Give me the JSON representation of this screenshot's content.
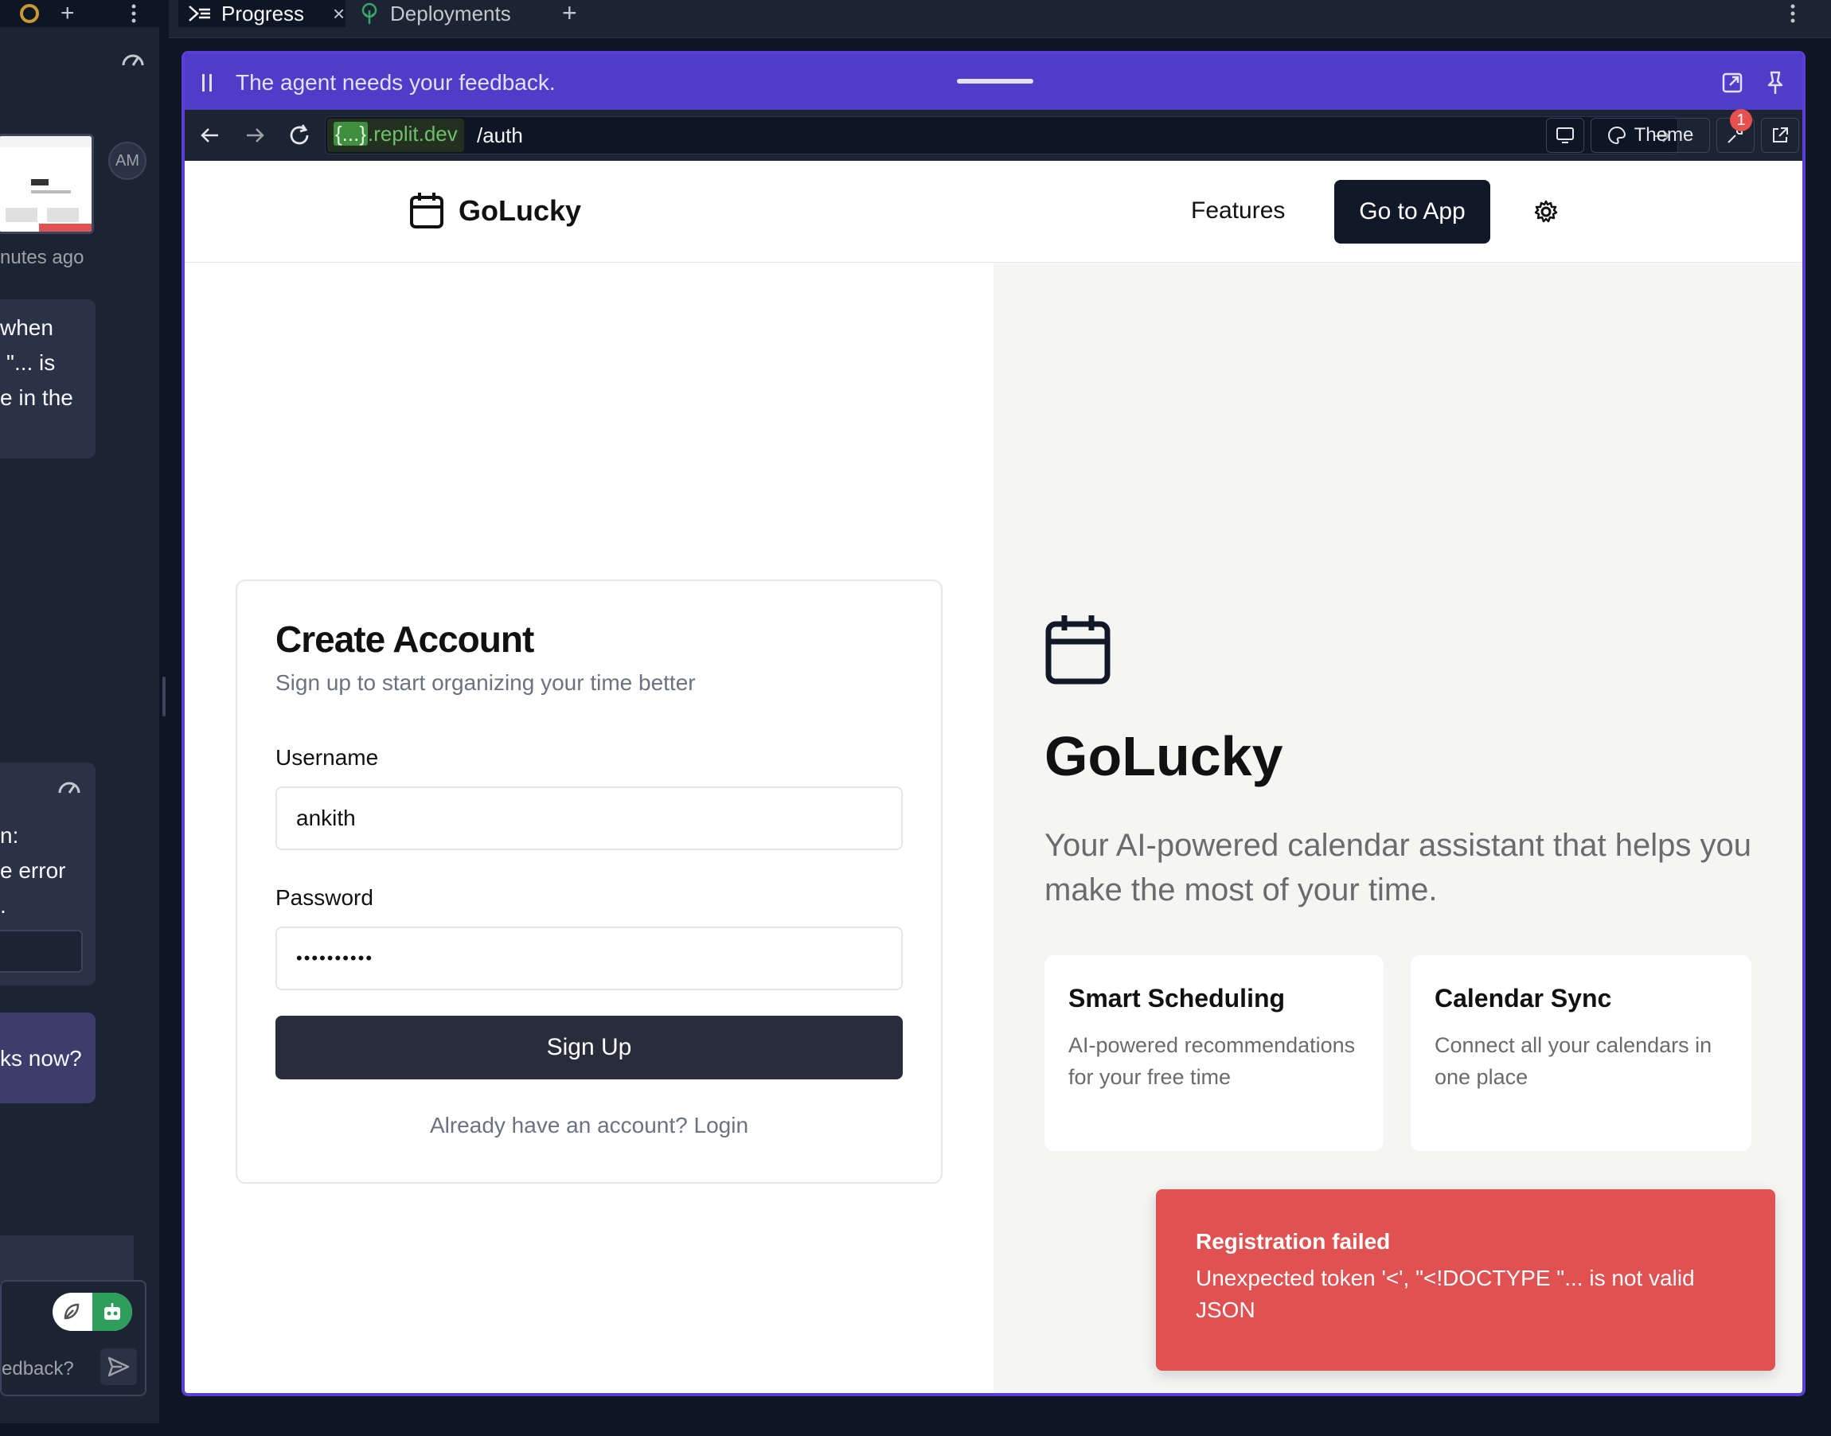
{
  "workspace": {
    "left_panel": {
      "timestamp": "nutes ago",
      "avatar": "AM",
      "message_1": [
        "when",
        "\"... is",
        "e in the"
      ],
      "message_2": [
        "n:",
        "e error",
        "."
      ],
      "message_3": "ks now?",
      "chat_placeholder": "edback?"
    },
    "tabs": [
      {
        "label": "Progress",
        "icon": "progress-icon"
      },
      {
        "label": "Deployments",
        "icon": "deployments-icon"
      }
    ]
  },
  "preview": {
    "feedback_banner": "The agent needs your feedback.",
    "url": {
      "domain": "{...}.replit.dev",
      "domain_prefix": "{...}",
      "domain_suffix": ".replit.dev",
      "path": "/auth"
    },
    "theme_label": "Theme",
    "notification_count": "1"
  },
  "app": {
    "brand": "GoLucky",
    "nav": {
      "features": "Features",
      "go_to_app": "Go to App"
    },
    "signup": {
      "title": "Create Account",
      "subtitle": "Sign up to start organizing your time better",
      "username_label": "Username",
      "username_value": "ankith",
      "password_label": "Password",
      "password_value": "••••••••••",
      "submit": "Sign Up",
      "login_link": "Already have an account? Login"
    },
    "hero": {
      "title": "GoLucky",
      "description": "Your AI-powered calendar assistant that helps you make the most of your time.",
      "features": [
        {
          "title": "Smart Scheduling",
          "text": "AI-powered recommendations for your free time"
        },
        {
          "title": "Calendar Sync",
          "text": "Connect all your calendars in one place"
        }
      ]
    },
    "toast": {
      "title": "Registration failed",
      "message": "Unexpected token '<', \"<!DOCTYPE \"... is not valid JSON"
    }
  },
  "colors": {
    "feedback_bar": "#4f3cc9",
    "primary_button": "#282d3c",
    "toast": "#e05151",
    "domain_green": "#4caf50"
  }
}
